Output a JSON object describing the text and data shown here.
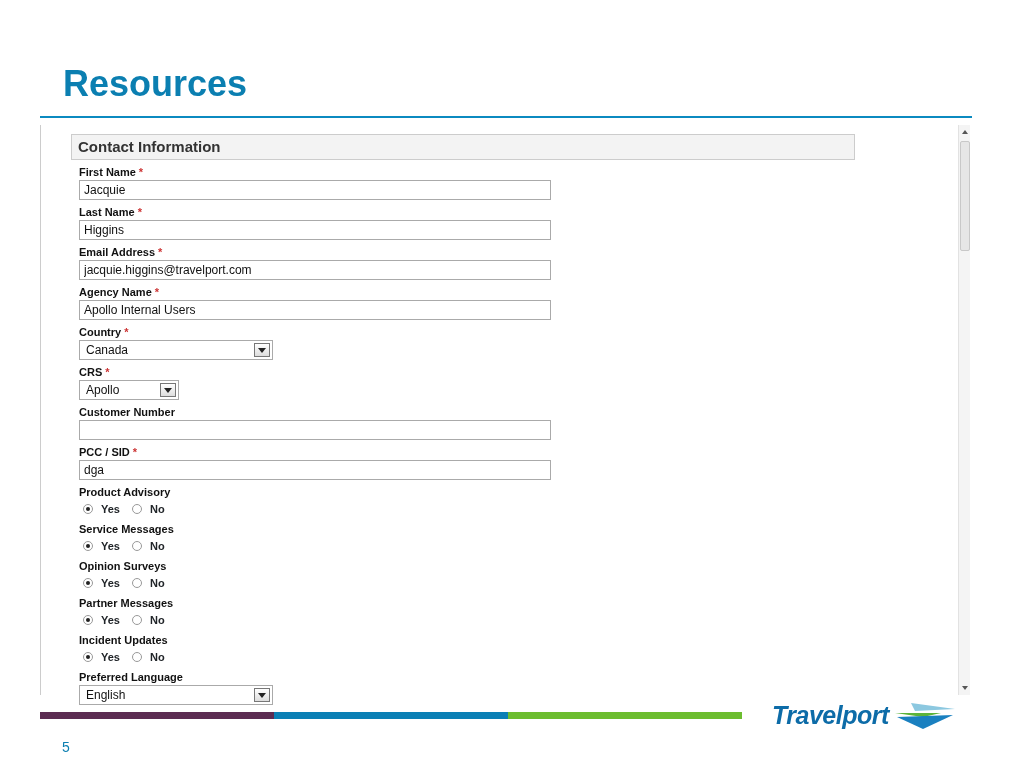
{
  "slide": {
    "title": "Resources",
    "page_number": "5",
    "logo": "Travelport"
  },
  "form": {
    "section_title": "Contact Information",
    "fields": [
      {
        "kind": "text",
        "label": "First Name",
        "marker": "*",
        "value": "Jacquie"
      },
      {
        "kind": "text",
        "label": "Last Name",
        "marker": "*",
        "value": "Higgins"
      },
      {
        "kind": "text",
        "label": "Email Address",
        "marker": "*",
        "value": "jacquie.higgins@travelport.com"
      },
      {
        "kind": "text",
        "label": "Agency Name",
        "marker": "*",
        "value": "Apollo Internal Users"
      },
      {
        "kind": "select",
        "label": "Country",
        "marker": "*",
        "value": "Canada"
      },
      {
        "kind": "select",
        "label": "CRS",
        "marker": "*",
        "value": "Apollo"
      },
      {
        "kind": "text",
        "label": "Customer Number"
      },
      {
        "kind": "text",
        "label": "PCC / SID",
        "marker": "*",
        "value": "dga"
      },
      {
        "kind": "radio",
        "label": "Product Advisory",
        "options": [
          {
            "label": "Yes",
            "selected": true
          },
          {
            "label": "No",
            "selected": false
          }
        ]
      },
      {
        "kind": "radio",
        "label": "Service Messages",
        "options": [
          {
            "label": "Yes",
            "selected": true
          },
          {
            "label": "No",
            "selected": false
          }
        ]
      },
      {
        "kind": "radio",
        "label": "Opinion Surveys",
        "options": [
          {
            "label": "Yes",
            "selected": true
          },
          {
            "label": "No",
            "selected": false
          }
        ]
      },
      {
        "kind": "radio",
        "label": "Partner Messages",
        "options": [
          {
            "label": "Yes",
            "selected": true
          },
          {
            "label": "No",
            "selected": false
          }
        ]
      },
      {
        "kind": "radio",
        "label": "Incident Updates",
        "options": [
          {
            "label": "Yes",
            "selected": true
          },
          {
            "label": "No",
            "selected": false
          }
        ]
      },
      {
        "kind": "select",
        "label": "Preferred Language",
        "value": "English"
      }
    ]
  }
}
